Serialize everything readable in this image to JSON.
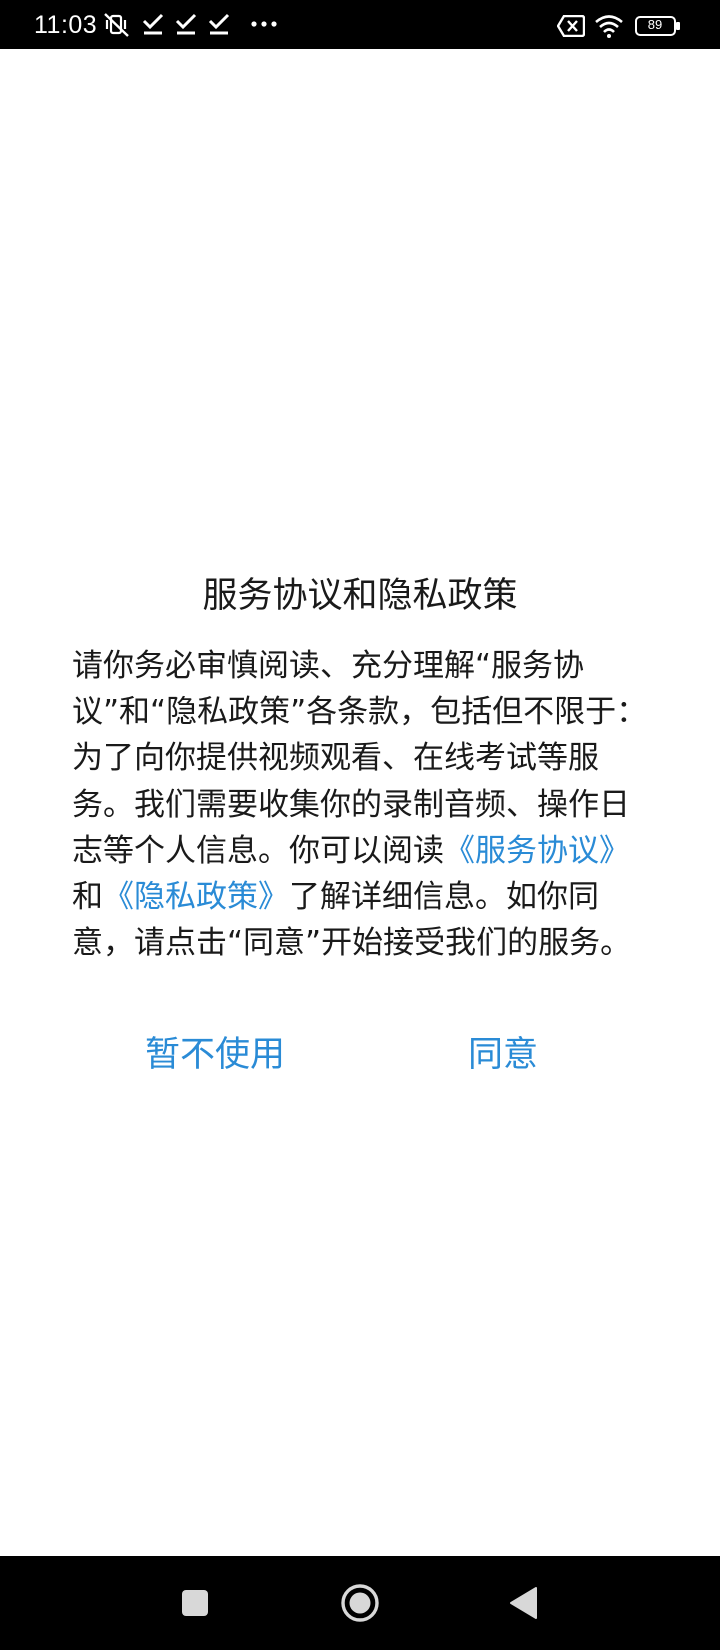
{
  "status_bar": {
    "time": "11:03",
    "battery": "89",
    "icons": [
      "vibrate-off-icon",
      "check-icon",
      "check-icon",
      "check-icon",
      "more-dots-icon",
      "sim-x-icon",
      "wifi-icon",
      "battery-icon"
    ]
  },
  "dialog": {
    "title": "服务协议和隐私政策",
    "body_pre": "请你务必审慎阅读、充分理解“服务协议”和“隐私政策”各条款，包括但不限于：为了向你提供视频观看、在线考试等服务。我们需要收集你的录制音频、操作日志等个人信息。你可以阅读",
    "link_service": "《服务协议》",
    "body_and": "和",
    "link_privacy": "《隐私政策》",
    "body_post": "了解详细信息。如你同意，请点击“同意”开始接受我们的服务。",
    "decline_label": "暂不使用",
    "agree_label": "同意"
  },
  "nav_bar": {
    "icons": [
      "recents-square-icon",
      "home-circle-icon",
      "back-triangle-icon"
    ]
  },
  "colors": {
    "link": "#2a8bd6",
    "text": "#1a1a1a",
    "bar": "#000000"
  }
}
